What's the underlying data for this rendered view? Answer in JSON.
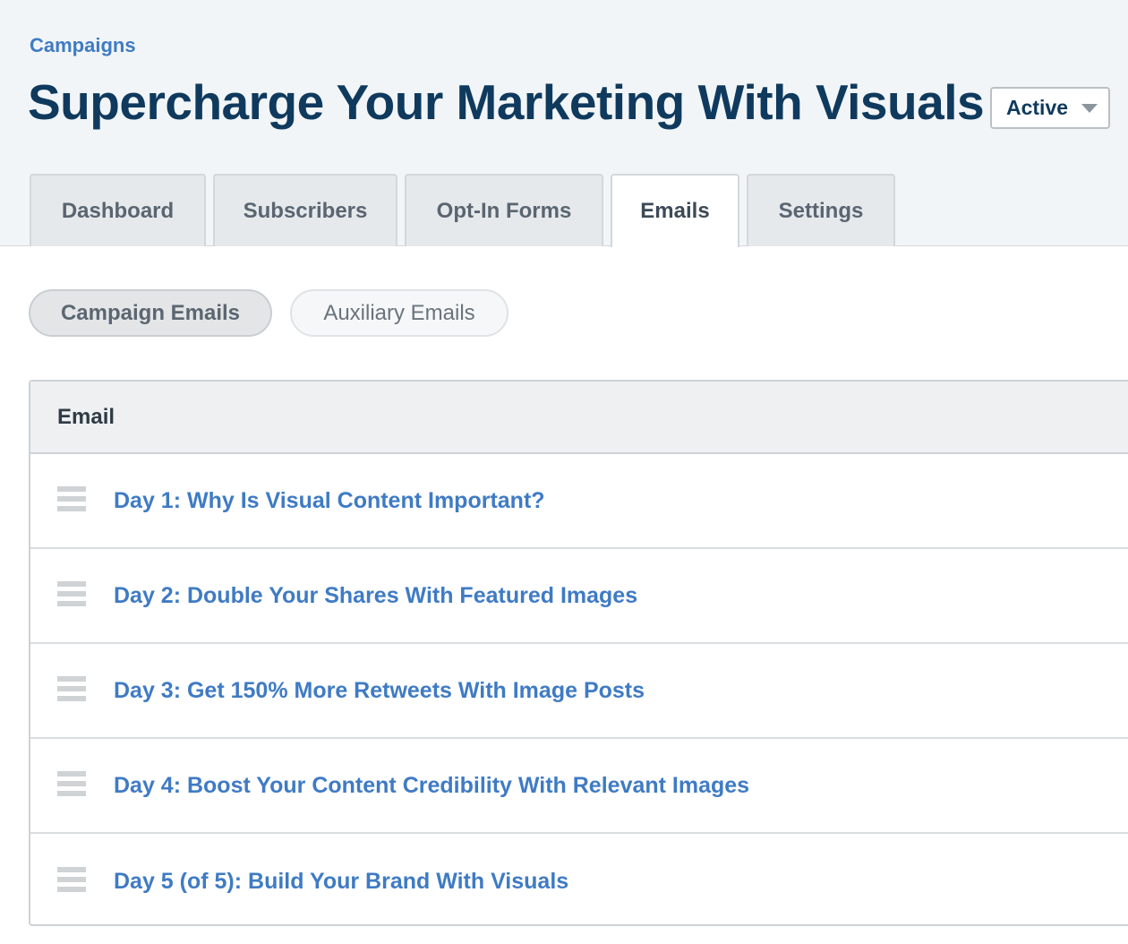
{
  "breadcrumb": {
    "label": "Campaigns"
  },
  "page": {
    "title": "Supercharge Your Marketing With Visuals"
  },
  "status": {
    "selected": "Active"
  },
  "tabs": [
    {
      "label": "Dashboard"
    },
    {
      "label": "Subscribers"
    },
    {
      "label": "Opt-In Forms"
    },
    {
      "label": "Emails",
      "active": true
    },
    {
      "label": "Settings"
    }
  ],
  "subtabs": [
    {
      "label": "Campaign Emails",
      "active": true
    },
    {
      "label": "Auxiliary Emails"
    }
  ],
  "table": {
    "header": "Email",
    "rows": [
      {
        "title": "Day 1: Why Is Visual Content Important?"
      },
      {
        "title": "Day 2: Double Your Shares With Featured Images"
      },
      {
        "title": "Day 3: Get 150% More Retweets With Image Posts"
      },
      {
        "title": "Day 4: Boost Your Content Credibility With Relevant Images"
      },
      {
        "title": "Day 5 (of 5): Build Your Brand With Visuals"
      }
    ]
  },
  "colors": {
    "link": "#3f7bc4",
    "title": "#0f3a5e",
    "header_bg": "#f2f5f7"
  },
  "icons": {
    "drag_handle": "drag-handle-icon",
    "status_caret": "caret-down-icon"
  }
}
